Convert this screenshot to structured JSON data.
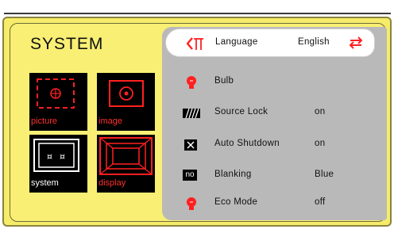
{
  "menu": {
    "title": "SYSTEM"
  },
  "tiles": [
    {
      "label": "picture"
    },
    {
      "label": "image"
    },
    {
      "label": "system"
    },
    {
      "label": "display"
    }
  ],
  "settings": [
    {
      "label": "Language",
      "value": "English"
    },
    {
      "label": "Bulb",
      "value": ""
    },
    {
      "label": "Source Lock",
      "value": "on"
    },
    {
      "label": "Auto Shutdown",
      "value": "on"
    },
    {
      "label": "Blanking",
      "value": "Blue",
      "icon_text": "no"
    },
    {
      "label": "Eco Mode",
      "value": "off"
    }
  ],
  "colors": {
    "accent": "#ff2020",
    "panel": "#b9b9b9",
    "frame": "#f6ec6a"
  },
  "icons": [
    "language-icon",
    "bulb-icon",
    "source-lock-icon",
    "close-icon",
    "blanking-badge",
    "eco-bulb-icon",
    "swap-arrows-icon"
  ]
}
